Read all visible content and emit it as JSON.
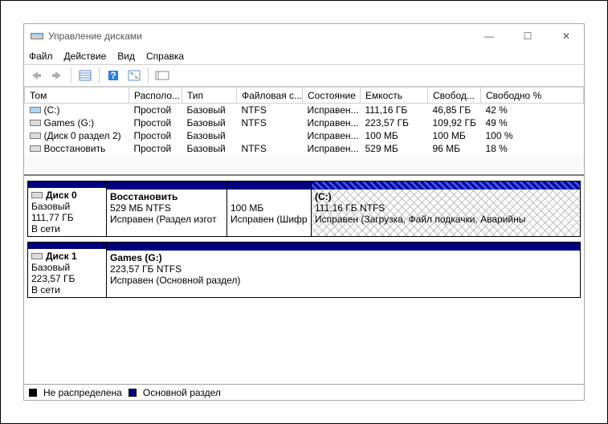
{
  "window": {
    "title": "Управление дисками"
  },
  "menu": {
    "file": "Файл",
    "action": "Действие",
    "view": "Вид",
    "help": "Справка"
  },
  "columns": {
    "c0": "Том",
    "c1": "Располо...",
    "c2": "Тип",
    "c3": "Файловая с...",
    "c4": "Состояние",
    "c5": "Емкость",
    "c6": "Свобод...",
    "c7": "Свободно %"
  },
  "rows": [
    {
      "name": "(C:)",
      "layout": "Простой",
      "type": "Базовый",
      "fs": "NTFS",
      "status": "Исправен...",
      "cap": "111,16 ГБ",
      "free": "46,85 ГБ",
      "pct": "42 %"
    },
    {
      "name": "Games (G:)",
      "layout": "Простой",
      "type": "Базовый",
      "fs": "NTFS",
      "status": "Исправен...",
      "cap": "223,57 ГБ",
      "free": "109,92 ГБ",
      "pct": "49 %"
    },
    {
      "name": "(Диск 0 раздел 2)",
      "layout": "Простой",
      "type": "Базовый",
      "fs": "",
      "status": "Исправен...",
      "cap": "100 МБ",
      "free": "100 МБ",
      "pct": "100 %"
    },
    {
      "name": "Восстановить",
      "layout": "Простой",
      "type": "Базовый",
      "fs": "NTFS",
      "status": "Исправен...",
      "cap": "529 МБ",
      "free": "96 МБ",
      "pct": "18 %"
    }
  ],
  "disks": [
    {
      "title": "Диск 0",
      "type": "Базовый",
      "size": "111,77 ГБ",
      "state": "В сети",
      "parts": [
        {
          "title": "Восстановить",
          "sub": "529 МБ NTFS",
          "status": "Исправен (Раздел изгот",
          "width": 150
        },
        {
          "title": "",
          "sub": "100 МБ",
          "status": "Исправен (Шифр",
          "width": 105
        },
        {
          "title": "(C:)",
          "sub": "111,16 ГБ NTFS",
          "status": "Исправен (Загрузка, Файл подкачки, Аварийны",
          "width": 0,
          "selected": true
        }
      ]
    },
    {
      "title": "Диск 1",
      "type": "Базовый",
      "size": "223,57 ГБ",
      "state": "В сети",
      "parts": [
        {
          "title": "Games  (G:)",
          "sub": "223,57 ГБ NTFS",
          "status": "Исправен (Основной раздел)",
          "width": 0
        }
      ]
    }
  ],
  "legend": {
    "unalloc": "Не распределена",
    "primary": "Основной раздел"
  },
  "icons": {
    "disk_svg": "<svg width='16' height='12' viewBox='0 0 16 12'><rect x='0' y='2' width='16' height='8' fill='#7a7a7a'/><rect x='1' y='3' width='14' height='6' fill='#cfcfcf'/><rect x='1' y='3' width='14' height='2' fill='#9ad0ff'/></svg>",
    "vol_blue": "<svg width='14' height='10' viewBox='0 0 14 10'><rect x='0' y='1' width='14' height='8' fill='#7a7a7a'/><rect x='1' y='2' width='12' height='6' fill='#a7d6ff'/></svg>",
    "vol_gray": "<svg width='14' height='10' viewBox='0 0 14 10'><rect x='0' y='1' width='14' height='8' fill='#7a7a7a'/><rect x='1' y='2' width='12' height='6' fill='#dcdcdc'/></svg>"
  }
}
